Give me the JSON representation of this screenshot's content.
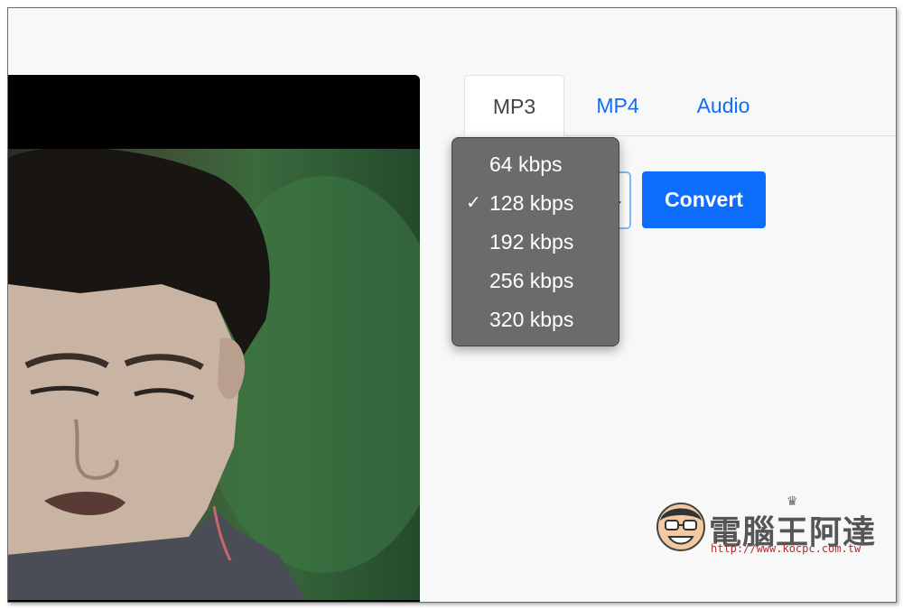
{
  "tabs": [
    {
      "label": "MP3",
      "active": true
    },
    {
      "label": "MP4",
      "active": false
    },
    {
      "label": "Audio",
      "active": false
    }
  ],
  "bitrate_select": {
    "selected": "128 kbps",
    "options": [
      "64 kbps",
      "128 kbps",
      "192 kbps",
      "256 kbps",
      "320 kbps"
    ],
    "check_glyph": "✓"
  },
  "convert_button": {
    "label": "Convert"
  },
  "watermark": {
    "title": "電腦王阿達",
    "url": "http://www.kocpc.com.tw"
  },
  "colors": {
    "accent": "#0d6efd",
    "dropdown_bg": "#6b6b6b",
    "watermark_url": "#c0282d"
  }
}
